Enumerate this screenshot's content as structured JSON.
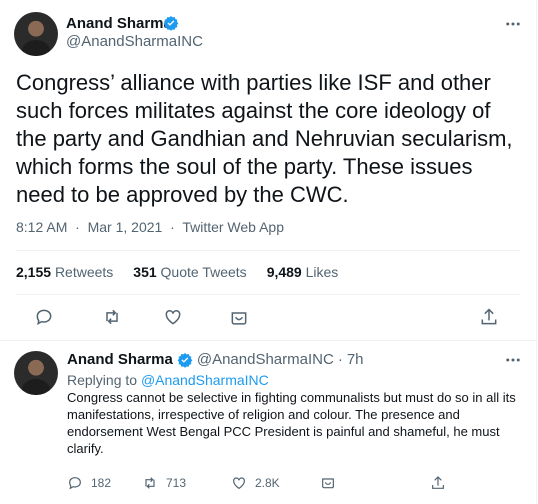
{
  "tweet": {
    "author_name": "Anand Sharma",
    "author_handle": "@AnandSharmaINC",
    "text": "Congress’ alliance with parties like ISF and other such forces militates against the core ideology of the party and Gandhian and Nehruvian secularism, which forms the soul of the party. These issues need to be approved by the CWC.",
    "time": "8:12 AM",
    "date": "Mar 1, 2021",
    "source": "Twitter Web App",
    "retweets_count": "2,155",
    "retweets_label": "Retweets",
    "quotes_count": "351",
    "quotes_label": "Quote Tweets",
    "likes_count": "9,489",
    "likes_label": "Likes"
  },
  "reply": {
    "author_name": "Anand Sharma",
    "author_handle": "@AnandSharmaINC",
    "age": "7h",
    "replying_prefix": "Replying to",
    "replying_to": "@AnandSharmaINC",
    "text": "Congress cannot be selective in fighting communalists but must do so in all its manifestations, irrespective of religion and colour. The presence and endorsement West Bengal PCC President is painful and shameful, he must clarify.",
    "reply_count": "182",
    "retweet_count": "713",
    "like_count": "2.8K"
  },
  "colors": {
    "accent": "#1d9bf0",
    "muted": "#536471"
  },
  "icons": [
    "more-icon",
    "verified-icon",
    "reply-icon",
    "retweet-icon",
    "like-icon",
    "share-icon",
    "upload-icon"
  ]
}
